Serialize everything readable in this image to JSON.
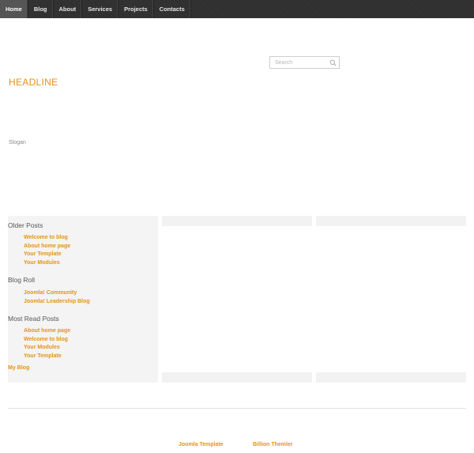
{
  "nav": {
    "items": [
      {
        "label": "Home",
        "active": true
      },
      {
        "label": "Blog"
      },
      {
        "label": "About"
      },
      {
        "label": "Services"
      },
      {
        "label": "Projects"
      },
      {
        "label": "Contacts"
      }
    ]
  },
  "search": {
    "placeholder": "Search",
    "icon": "search-icon"
  },
  "header": {
    "headline": "HEADLINE",
    "slogan": "Slogan"
  },
  "sidebar": {
    "older_posts": {
      "title": "Older Posts",
      "items": [
        "Welcome to blog",
        "About home page",
        "Your Template",
        "Your Modules"
      ]
    },
    "blog_roll": {
      "title": "Blog Roll",
      "items": [
        "Joomla! Community",
        "Joomla! Leadership Blog"
      ]
    },
    "most_read": {
      "title": "Most Read Posts",
      "items": [
        "About home page",
        "Welcome to blog",
        "Your Modules",
        "Your Template"
      ]
    },
    "my_blog": "My Blog"
  },
  "footer": {
    "links": [
      "Joomla Template",
      "Billion Themler"
    ]
  },
  "colors": {
    "accent": "#e69118",
    "nav_bg": "#2f2f2f",
    "sidebar_bg": "#f4f4f4"
  }
}
